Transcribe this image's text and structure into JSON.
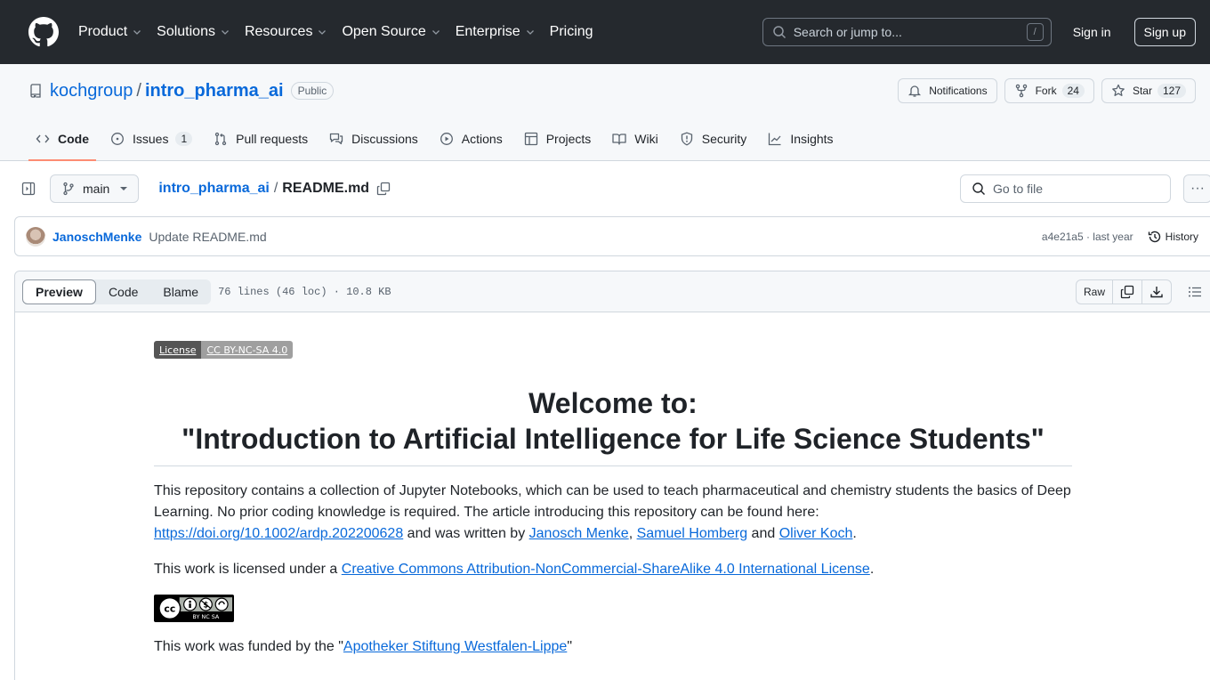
{
  "header": {
    "nav": [
      {
        "label": "Product",
        "has_dropdown": true
      },
      {
        "label": "Solutions",
        "has_dropdown": true
      },
      {
        "label": "Resources",
        "has_dropdown": true
      },
      {
        "label": "Open Source",
        "has_dropdown": true
      },
      {
        "label": "Enterprise",
        "has_dropdown": true
      },
      {
        "label": "Pricing",
        "has_dropdown": false
      }
    ],
    "search_placeholder": "Search or jump to...",
    "search_shortcut": "/",
    "sign_in": "Sign in",
    "sign_up": "Sign up"
  },
  "repo": {
    "owner": "kochgroup",
    "separator": "/",
    "name": "intro_pharma_ai",
    "visibility": "Public",
    "notifications_label": "Notifications",
    "fork_label": "Fork",
    "fork_count": "24",
    "star_label": "Star",
    "star_count": "127",
    "tabs": [
      {
        "label": "Code",
        "icon": "code-icon",
        "active": true
      },
      {
        "label": "Issues",
        "icon": "issue-icon",
        "count": "1"
      },
      {
        "label": "Pull requests",
        "icon": "pull-request-icon"
      },
      {
        "label": "Discussions",
        "icon": "discussions-icon"
      },
      {
        "label": "Actions",
        "icon": "play-icon"
      },
      {
        "label": "Projects",
        "icon": "table-icon"
      },
      {
        "label": "Wiki",
        "icon": "book-icon"
      },
      {
        "label": "Security",
        "icon": "shield-icon"
      },
      {
        "label": "Insights",
        "icon": "graph-icon"
      }
    ]
  },
  "file_nav": {
    "branch": "main",
    "breadcrumb_repo": "intro_pharma_ai",
    "breadcrumb_sep": "/",
    "file_name": "README.md",
    "goto_placeholder": "Go to file",
    "more": "···"
  },
  "commit": {
    "author": "JanoschMenke",
    "message": "Update README.md",
    "sha_time": "a4e21a5 · last year",
    "history_label": "History"
  },
  "file": {
    "view_tabs": [
      "Preview",
      "Code",
      "Blame"
    ],
    "active_view": "Preview",
    "meta": "76 lines (46 loc) · 10.8 KB",
    "raw_label": "Raw"
  },
  "readme": {
    "license_badge": {
      "left": "License",
      "right": "CC BY-NC-SA 4.0"
    },
    "title_line1": "Welcome to:",
    "title_line2": "\"Introduction to Artificial Intelligence for Life Science Students\"",
    "p1_text": "This repository contains a collection of Jupyter Notebooks, which can be used to teach pharmaceutical and chemistry students the basics of Deep Learning. No prior coding knowledge is required. The article introducing this repository can be found here: ",
    "p1_doi": "https://doi.org/10.1002/ardp.202200628",
    "p1_mid": " and was written by ",
    "author1": "Janosch Menke",
    "comma": ", ",
    "author2": "Samuel Homberg",
    "and": " and ",
    "author3": "Oliver Koch",
    "period": ".",
    "p2_text": "This work is licensed under a ",
    "p2_link": "Creative Commons Attribution-NonCommercial-ShareAlike 4.0 International License",
    "cc_badge_labels": "BY  NC  SA",
    "p3_text": "This work was funded by the \"",
    "p3_link": "Apotheker Stiftung Westfalen-Lippe",
    "p3_end": "\""
  }
}
